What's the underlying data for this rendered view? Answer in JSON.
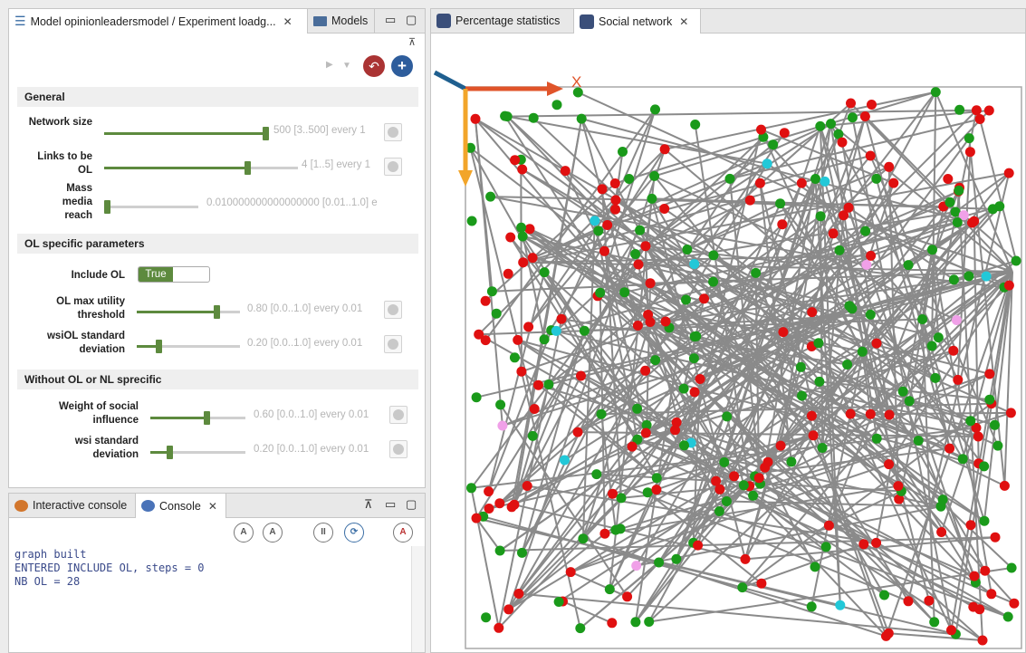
{
  "param_panel": {
    "tab_experiment": "Model opinionleadersmodel / Experiment loadg...",
    "tab_models": "Models",
    "sections": {
      "general": "General",
      "ol_specific": "OL specific parameters",
      "without_ol": "Without OL or NL sprecific"
    },
    "params": {
      "network_size": {
        "label": "Network size",
        "value_text": "500 [3..500] every 1",
        "level": 1.0
      },
      "links_to_be_ol": {
        "label": "Links to be OL",
        "value_text": "4 [1..5] every 1",
        "level": 0.75
      },
      "mass_media_reach": {
        "label": "Mass media reach",
        "value_text": "0.010000000000000000 [0.01..1.0] e",
        "level": 0.0
      },
      "include_ol": {
        "label": "Include OL",
        "value_text": "True"
      },
      "ol_max_utility": {
        "label": "OL max utility threshold",
        "value_text": "0.80 [0.0..1.0] every 0.01",
        "level": 0.8
      },
      "wsiol_std": {
        "label": "wsiOL standard deviation",
        "value_text": "0.20 [0.0..1.0] every 0.01",
        "level": 0.2
      },
      "weight_social": {
        "label": "Weight of social influence",
        "value_text": "0.60 [0.0..1.0] every 0.01",
        "level": 0.6
      },
      "wsi_std": {
        "label": "wsi standard deviation",
        "value_text": "0.20 [0.0..1.0] every 0.01",
        "level": 0.2
      }
    }
  },
  "console_panel": {
    "tab_interactive": "Interactive console",
    "tab_console": "Console",
    "lines": [
      "graph built",
      "ENTERED INCLUDE OL, steps = 0",
      "NB OL = 28"
    ]
  },
  "display_panel": {
    "tab_percentage": "Percentage statistics",
    "tab_social": "Social network",
    "axis_x_label": "X"
  },
  "colors": {
    "accent_green": "#5d8a3e",
    "node_red": "#e01010",
    "node_green": "#1a9a1a",
    "node_cyan": "#22c8d8",
    "node_pink": "#f0a0e8",
    "edge_gray": "#8a8a8a",
    "axis_orange": "#e0542a",
    "axis_yellow": "#f2a52a",
    "axis_blue": "#1f5f8f"
  }
}
